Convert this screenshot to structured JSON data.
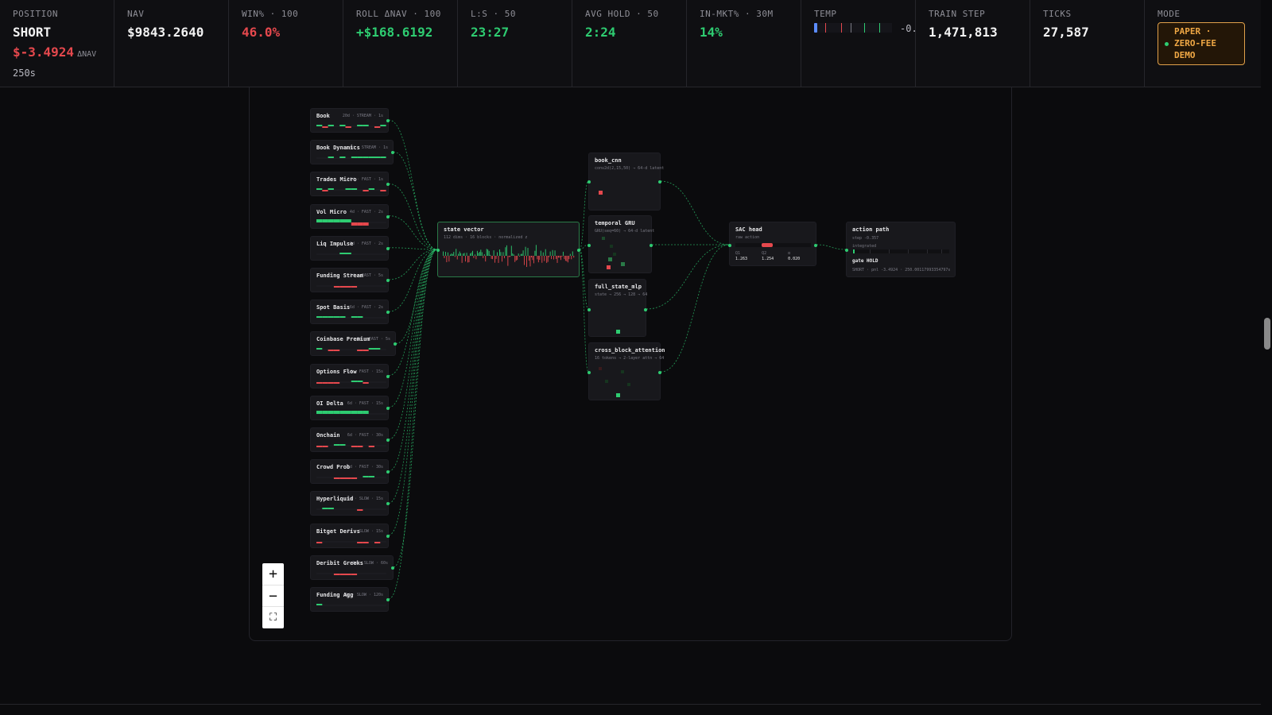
{
  "stats": [
    {
      "key": "position",
      "label": "POSITION",
      "value": "SHORT",
      "color": "white"
    },
    {
      "key": "nav",
      "label": "NAV",
      "value": "$9843.2640",
      "color": "white"
    },
    {
      "key": "win",
      "label": "WIN% · 100",
      "value": "46.0%",
      "color": "red"
    },
    {
      "key": "roll",
      "label": "ROLL ΔNAV · 100",
      "value": "+$168.6192",
      "color": "green"
    },
    {
      "key": "ls",
      "label": "L:S · 50",
      "value": "23:27",
      "color": "green"
    },
    {
      "key": "avghold",
      "label": "AVG HOLD · 50",
      "value": "2:24",
      "color": "green"
    },
    {
      "key": "inmkt",
      "label": "IN-MKT% · 30M",
      "value": "14%",
      "color": "green"
    },
    {
      "key": "temp",
      "label": "TEMP",
      "value": "-0.",
      "color": "white"
    },
    {
      "key": "train",
      "label": "TRAIN STEP",
      "value": "1,471,813",
      "color": "white"
    },
    {
      "key": "ticks",
      "label": "TICKS",
      "value": "27,587",
      "color": "white"
    },
    {
      "key": "mode",
      "label": "MODE",
      "value": "",
      "color": "white"
    }
  ],
  "position_detail": {
    "pnl": "$-3.4924",
    "unit": "ΔNAV",
    "hold": "250s"
  },
  "mode_badge": {
    "line1": "PAPER ·",
    "line2": "ZERO-FEE",
    "line3": "DEMO"
  },
  "colors": {
    "green": "#2ecc71",
    "red": "#e5484d",
    "accent": "#f0a845",
    "blue": "#5b8cff"
  },
  "feature_nodes": [
    {
      "title": "Book",
      "meta": "20d · STREAM · 1s"
    },
    {
      "title": "Book Dynamics",
      "meta": "4d · STREAM · 1s"
    },
    {
      "title": "Trades Micro",
      "meta": "10d · FAST · 1s"
    },
    {
      "title": "Vol Micro",
      "meta": "4d · FAST · 2s"
    },
    {
      "title": "Liq Impulse",
      "meta": "3d · FAST · 2s"
    },
    {
      "title": "Funding Stream",
      "meta": "3d · FAST · 5s"
    },
    {
      "title": "Spot Basis",
      "meta": "6d · FAST · 2s"
    },
    {
      "title": "Coinbase Premium",
      "meta": "3d · FAST · 5s"
    },
    {
      "title": "Options Flow",
      "meta": "6d · FAST · 15s"
    },
    {
      "title": "OI Delta",
      "meta": "6d · FAST · 15s"
    },
    {
      "title": "Onchain",
      "meta": "6d · FAST · 30s"
    },
    {
      "title": "Crowd Prob",
      "meta": "5d · FAST · 30s"
    },
    {
      "title": "Hyperliquid",
      "meta": "6d · SLOW · 15s"
    },
    {
      "title": "Bitget Derivs",
      "meta": "7d · SLOW · 15s"
    },
    {
      "title": "Deribit Greeks",
      "meta": "7d · SLOW · 60s"
    },
    {
      "title": "Funding Agg",
      "meta": "4d · SLOW · 120s"
    }
  ],
  "state_vector": {
    "title": "state vector",
    "sub": "112 dims · 16 blocks · normalized z"
  },
  "encoders": [
    {
      "key": "book_cnn",
      "title": "book_cnn",
      "sub": "conv2d(2,15,50) → 64-d latent"
    },
    {
      "key": "temporal_gru",
      "title": "temporal GRU",
      "sub": "GRU(seq=60) → 64-d latent"
    },
    {
      "key": "full_state_mlp",
      "title": "full_state_mlp",
      "sub": "state → 256 → 128 → 64"
    },
    {
      "key": "cross_block_attention",
      "title": "cross_block_attention",
      "sub": "16 tokens → 2-layer attn → 64"
    }
  ],
  "sac_head": {
    "title": "SAC head",
    "sub": "raw action",
    "cols": [
      {
        "k": "Q1",
        "v": "1.263"
      },
      {
        "k": "Q2",
        "v": "1.254"
      },
      {
        "k": "α",
        "v": "0.020"
      }
    ],
    "action_level": 0.42
  },
  "action_path": {
    "title": "action path",
    "step": "step -0.357",
    "integrated": "integrated",
    "gate": "gate HOLD",
    "foot": "SHORT · pnl -3.4924 · 250.00117993354797s"
  },
  "zoom": {
    "plus": "+",
    "minus": "−",
    "fit": "⛶"
  }
}
